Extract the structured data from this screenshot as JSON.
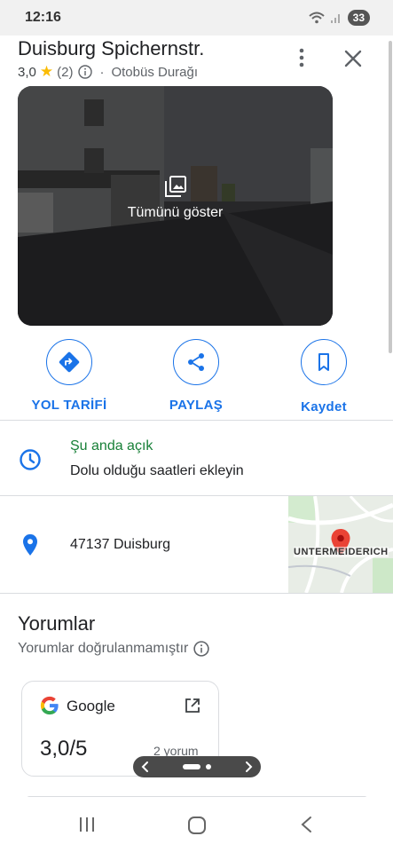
{
  "status_bar": {
    "time": "12:16",
    "battery": "33"
  },
  "place": {
    "title": "Duisburg Spichernstr.",
    "rating": "3,0",
    "review_count_paren": "(2)",
    "category": "Otobüs Durağı"
  },
  "photo": {
    "show_all_label": "Tümünü göster"
  },
  "actions": [
    {
      "label": "YOL TARİFİ",
      "icon": "directions-icon"
    },
    {
      "label": "PAYLAŞ",
      "icon": "share-icon"
    },
    {
      "label": "Kaydet",
      "icon": "bookmark-icon"
    }
  ],
  "hours": {
    "status": "Şu anda açık",
    "add_hours": "Dolu olduğu saatleri ekleyin"
  },
  "address": {
    "text": "47137 Duisburg",
    "map_label": "UNTERMEIDERICH"
  },
  "reviews": {
    "title": "Yorumlar",
    "subtitle": "Yorumlar doğrulanmamıştır",
    "card": {
      "source": "Google",
      "score": "3,0/5",
      "count": "2 yorum"
    }
  },
  "colors": {
    "accent": "#1a73e8",
    "open_green": "#188038",
    "pin_red": "#ea4335",
    "star": "#fbbc04"
  }
}
